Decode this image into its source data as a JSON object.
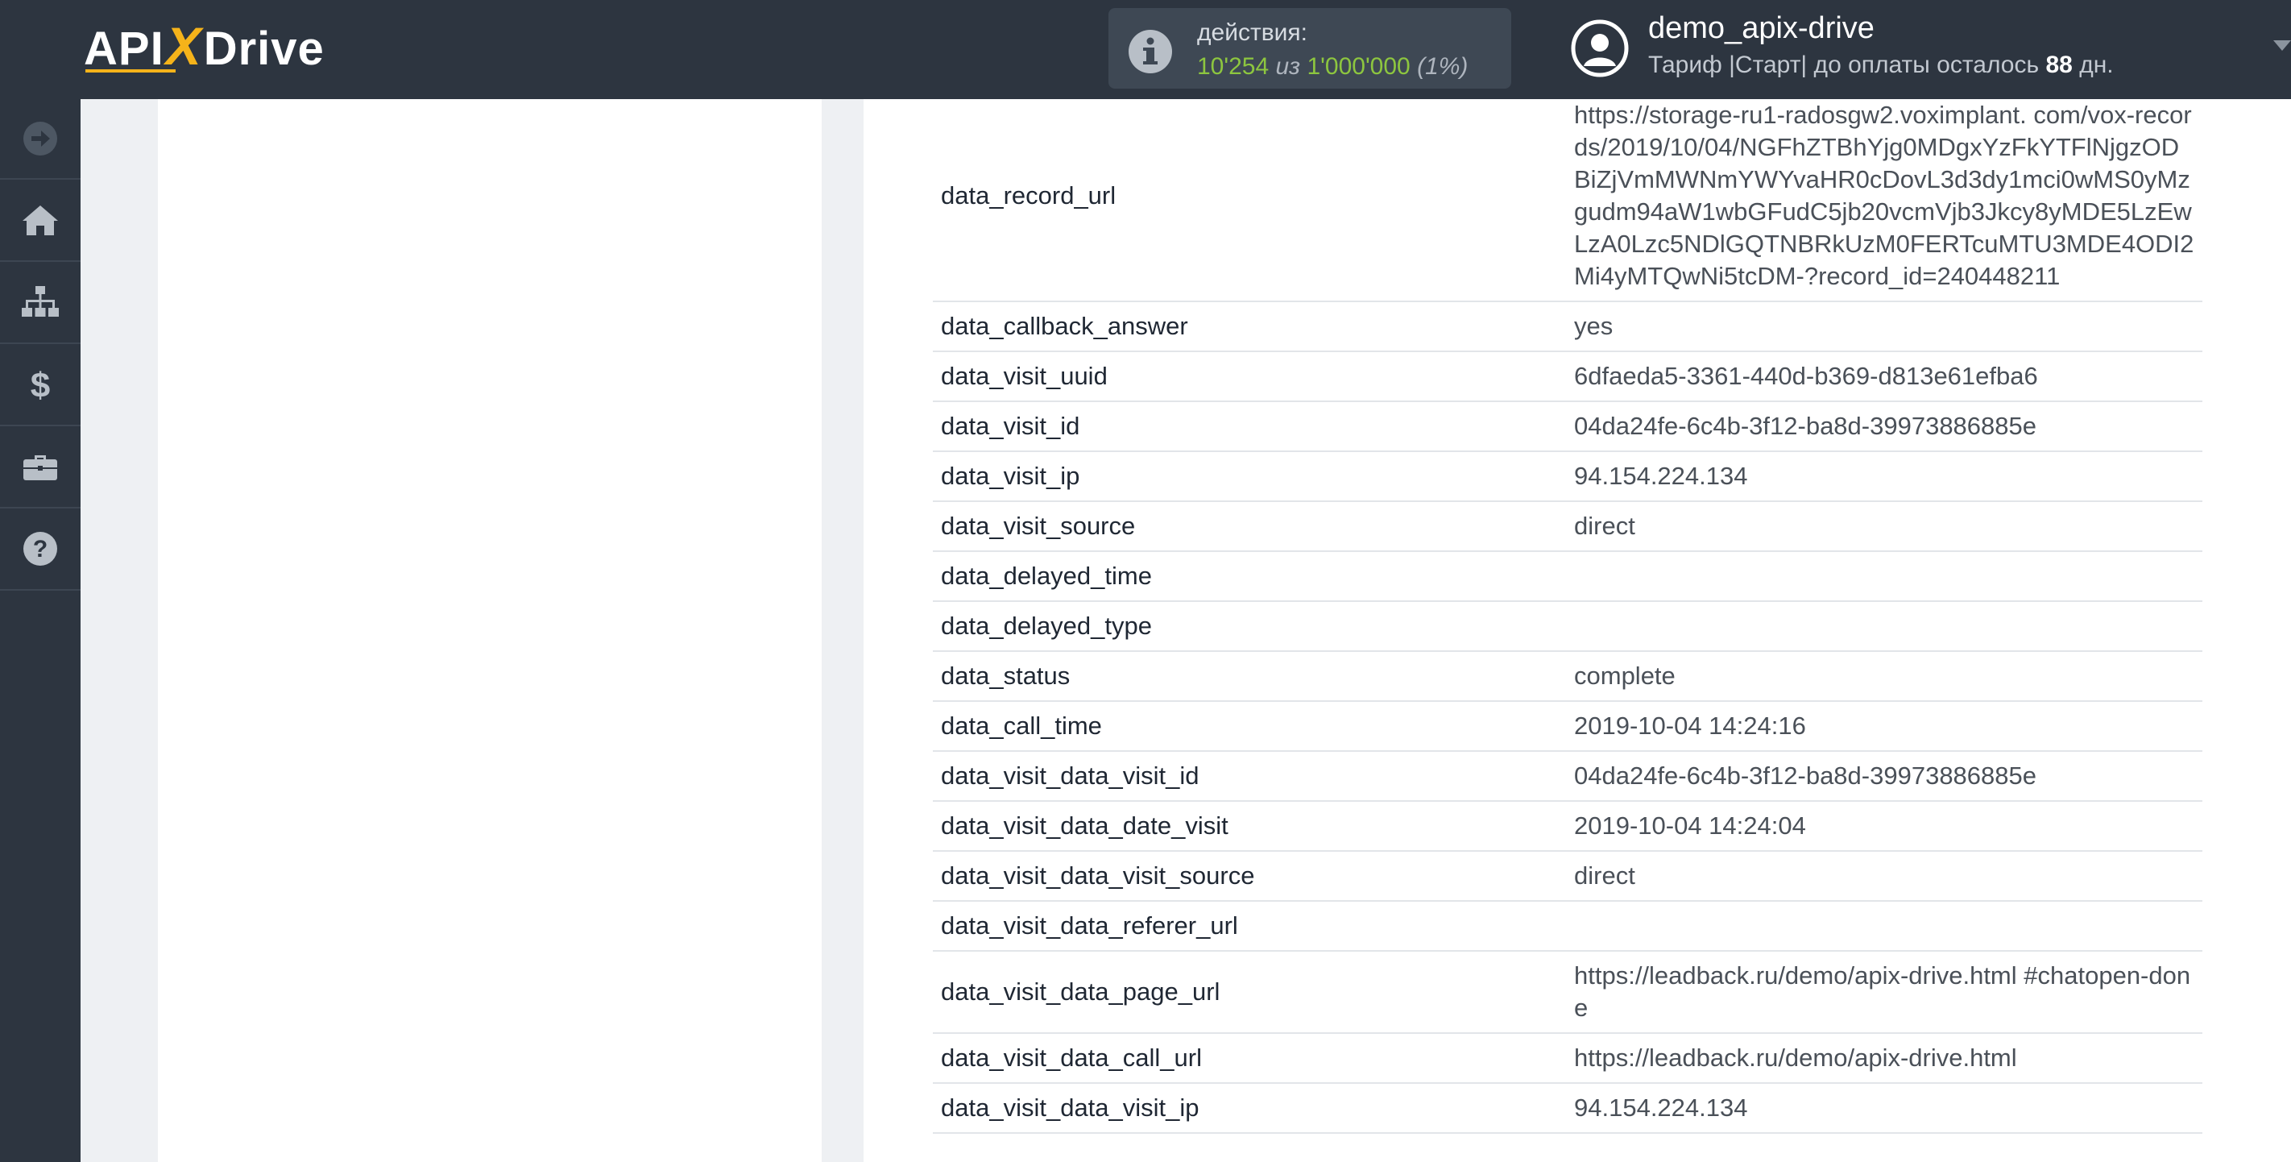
{
  "header": {
    "logo_text_left": "API",
    "logo_text_x": "X",
    "logo_text_right": "Drive",
    "actions_label": "действия:",
    "actions_used": "10'254",
    "actions_separator": "из",
    "actions_total": "1'000'000",
    "actions_percent": "(1%)",
    "user_name": "demo_apix-drive",
    "plan_prefix": "Тариф |Старт| до оплаты осталось",
    "plan_days": "88",
    "plan_suffix": "дн."
  },
  "sidebar": {
    "items": [
      {
        "icon": "arrow-right-circle-icon"
      },
      {
        "icon": "home-icon"
      },
      {
        "icon": "sitemap-icon"
      },
      {
        "icon": "dollar-icon"
      },
      {
        "icon": "briefcase-icon"
      },
      {
        "icon": "help-icon"
      }
    ]
  },
  "colors": {
    "topbar": "#2d3540",
    "accent_yellow": "#f5b31a",
    "actions_green": "#8dc63f"
  },
  "fields": [
    {
      "key": "data_record_url",
      "value": "https://storage-ru1-radosgw2.voximplant. com/vox-records/2019/10/04/NGFhZTBhYjg0MDgxYzFkYTFlNjgzODBiZjVmMWNmYWYvaHR0cDovL3d3dy1mci0wMS0yMzgudm94aW1wbGFudC5jb20vcmVjb3Jkcy8yMDE5LzEwLzA0Lzc5NDlGQTNBRkUzM0FERTcuMTU3MDE4ODI2Mi4yMTQwNi5tcDM-?record_id=240448211"
    },
    {
      "key": "data_callback_answer",
      "value": "yes"
    },
    {
      "key": "data_visit_uuid",
      "value": "6dfaeda5-3361-440d-b369-d813e61efba6"
    },
    {
      "key": "data_visit_id",
      "value": "04da24fe-6c4b-3f12-ba8d-39973886885e"
    },
    {
      "key": "data_visit_ip",
      "value": "94.154.224.134"
    },
    {
      "key": "data_visit_source",
      "value": "direct"
    },
    {
      "key": "data_delayed_time",
      "value": ""
    },
    {
      "key": "data_delayed_type",
      "value": ""
    },
    {
      "key": "data_status",
      "value": "complete"
    },
    {
      "key": "data_call_time",
      "value": "2019-10-04 14:24:16"
    },
    {
      "key": "data_visit_data_visit_id",
      "value": "04da24fe-6c4b-3f12-ba8d-39973886885e"
    },
    {
      "key": "data_visit_data_date_visit",
      "value": "2019-10-04 14:24:04"
    },
    {
      "key": "data_visit_data_visit_source",
      "value": "direct"
    },
    {
      "key": "data_visit_data_referer_url",
      "value": ""
    },
    {
      "key": "data_visit_data_page_url",
      "value": "https://leadback.ru/demo/apix-drive.html #chatopen-done"
    },
    {
      "key": "data_visit_data_call_url",
      "value": "https://leadback.ru/demo/apix-drive.html"
    },
    {
      "key": "data_visit_data_visit_ip",
      "value": "94.154.224.134"
    }
  ]
}
